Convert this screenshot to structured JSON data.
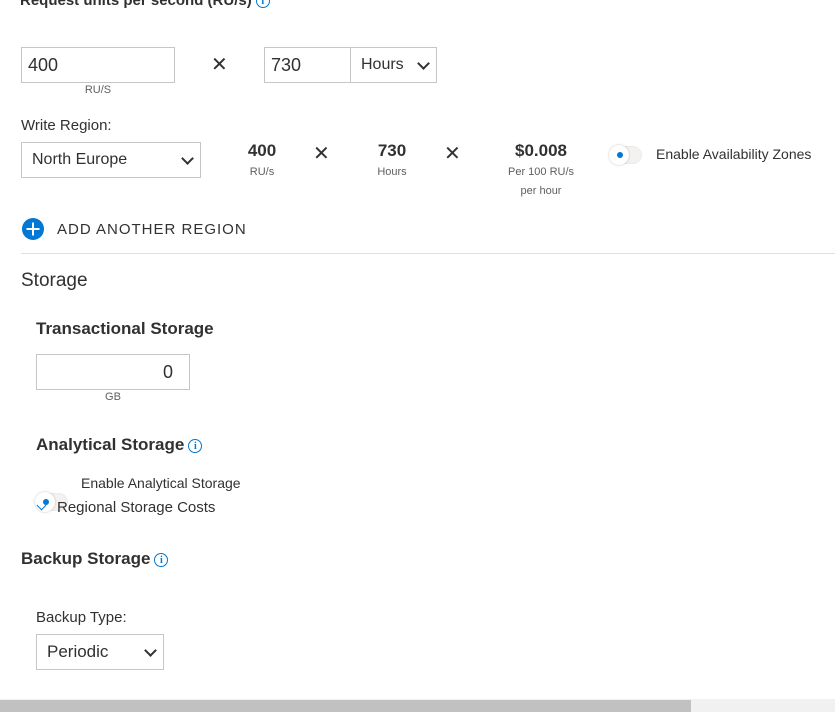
{
  "ru": {
    "heading": "Request units per second (RU/s)",
    "value": "400",
    "unit_caption": "RU/S",
    "hours_value": "730",
    "hours_select": "Hours"
  },
  "region": {
    "label": "Write Region:",
    "selected": "North Europe",
    "ru_value": "400",
    "ru_caption": "RU/s",
    "hours_value": "730",
    "hours_caption": "Hours",
    "price": "$0.008",
    "price_caption_1": "Per 100 RU/s",
    "price_caption_2": "per hour",
    "az_label": "Enable Availability Zones",
    "az_enabled": false,
    "add_region": "ADD ANOTHER REGION"
  },
  "storage": {
    "title": "Storage",
    "transactional_title": "Transactional Storage",
    "transactional_value": "0",
    "transactional_unit": "GB",
    "analytical_title": "Analytical Storage",
    "analytical_toggle_label": "Enable Analytical Storage",
    "analytical_enabled": false,
    "regional_costs": "Regional Storage Costs",
    "backup_title": "Backup Storage",
    "backup_type_label": "Backup Type:",
    "backup_type": "Periodic"
  },
  "icons": {
    "info": "info-icon",
    "times": "times-icon",
    "add": "plus-circle-icon",
    "chevron": "chevron-down-icon"
  },
  "colors": {
    "accent": "#0078d4",
    "text": "#323130",
    "border": "#c8c6c4"
  }
}
